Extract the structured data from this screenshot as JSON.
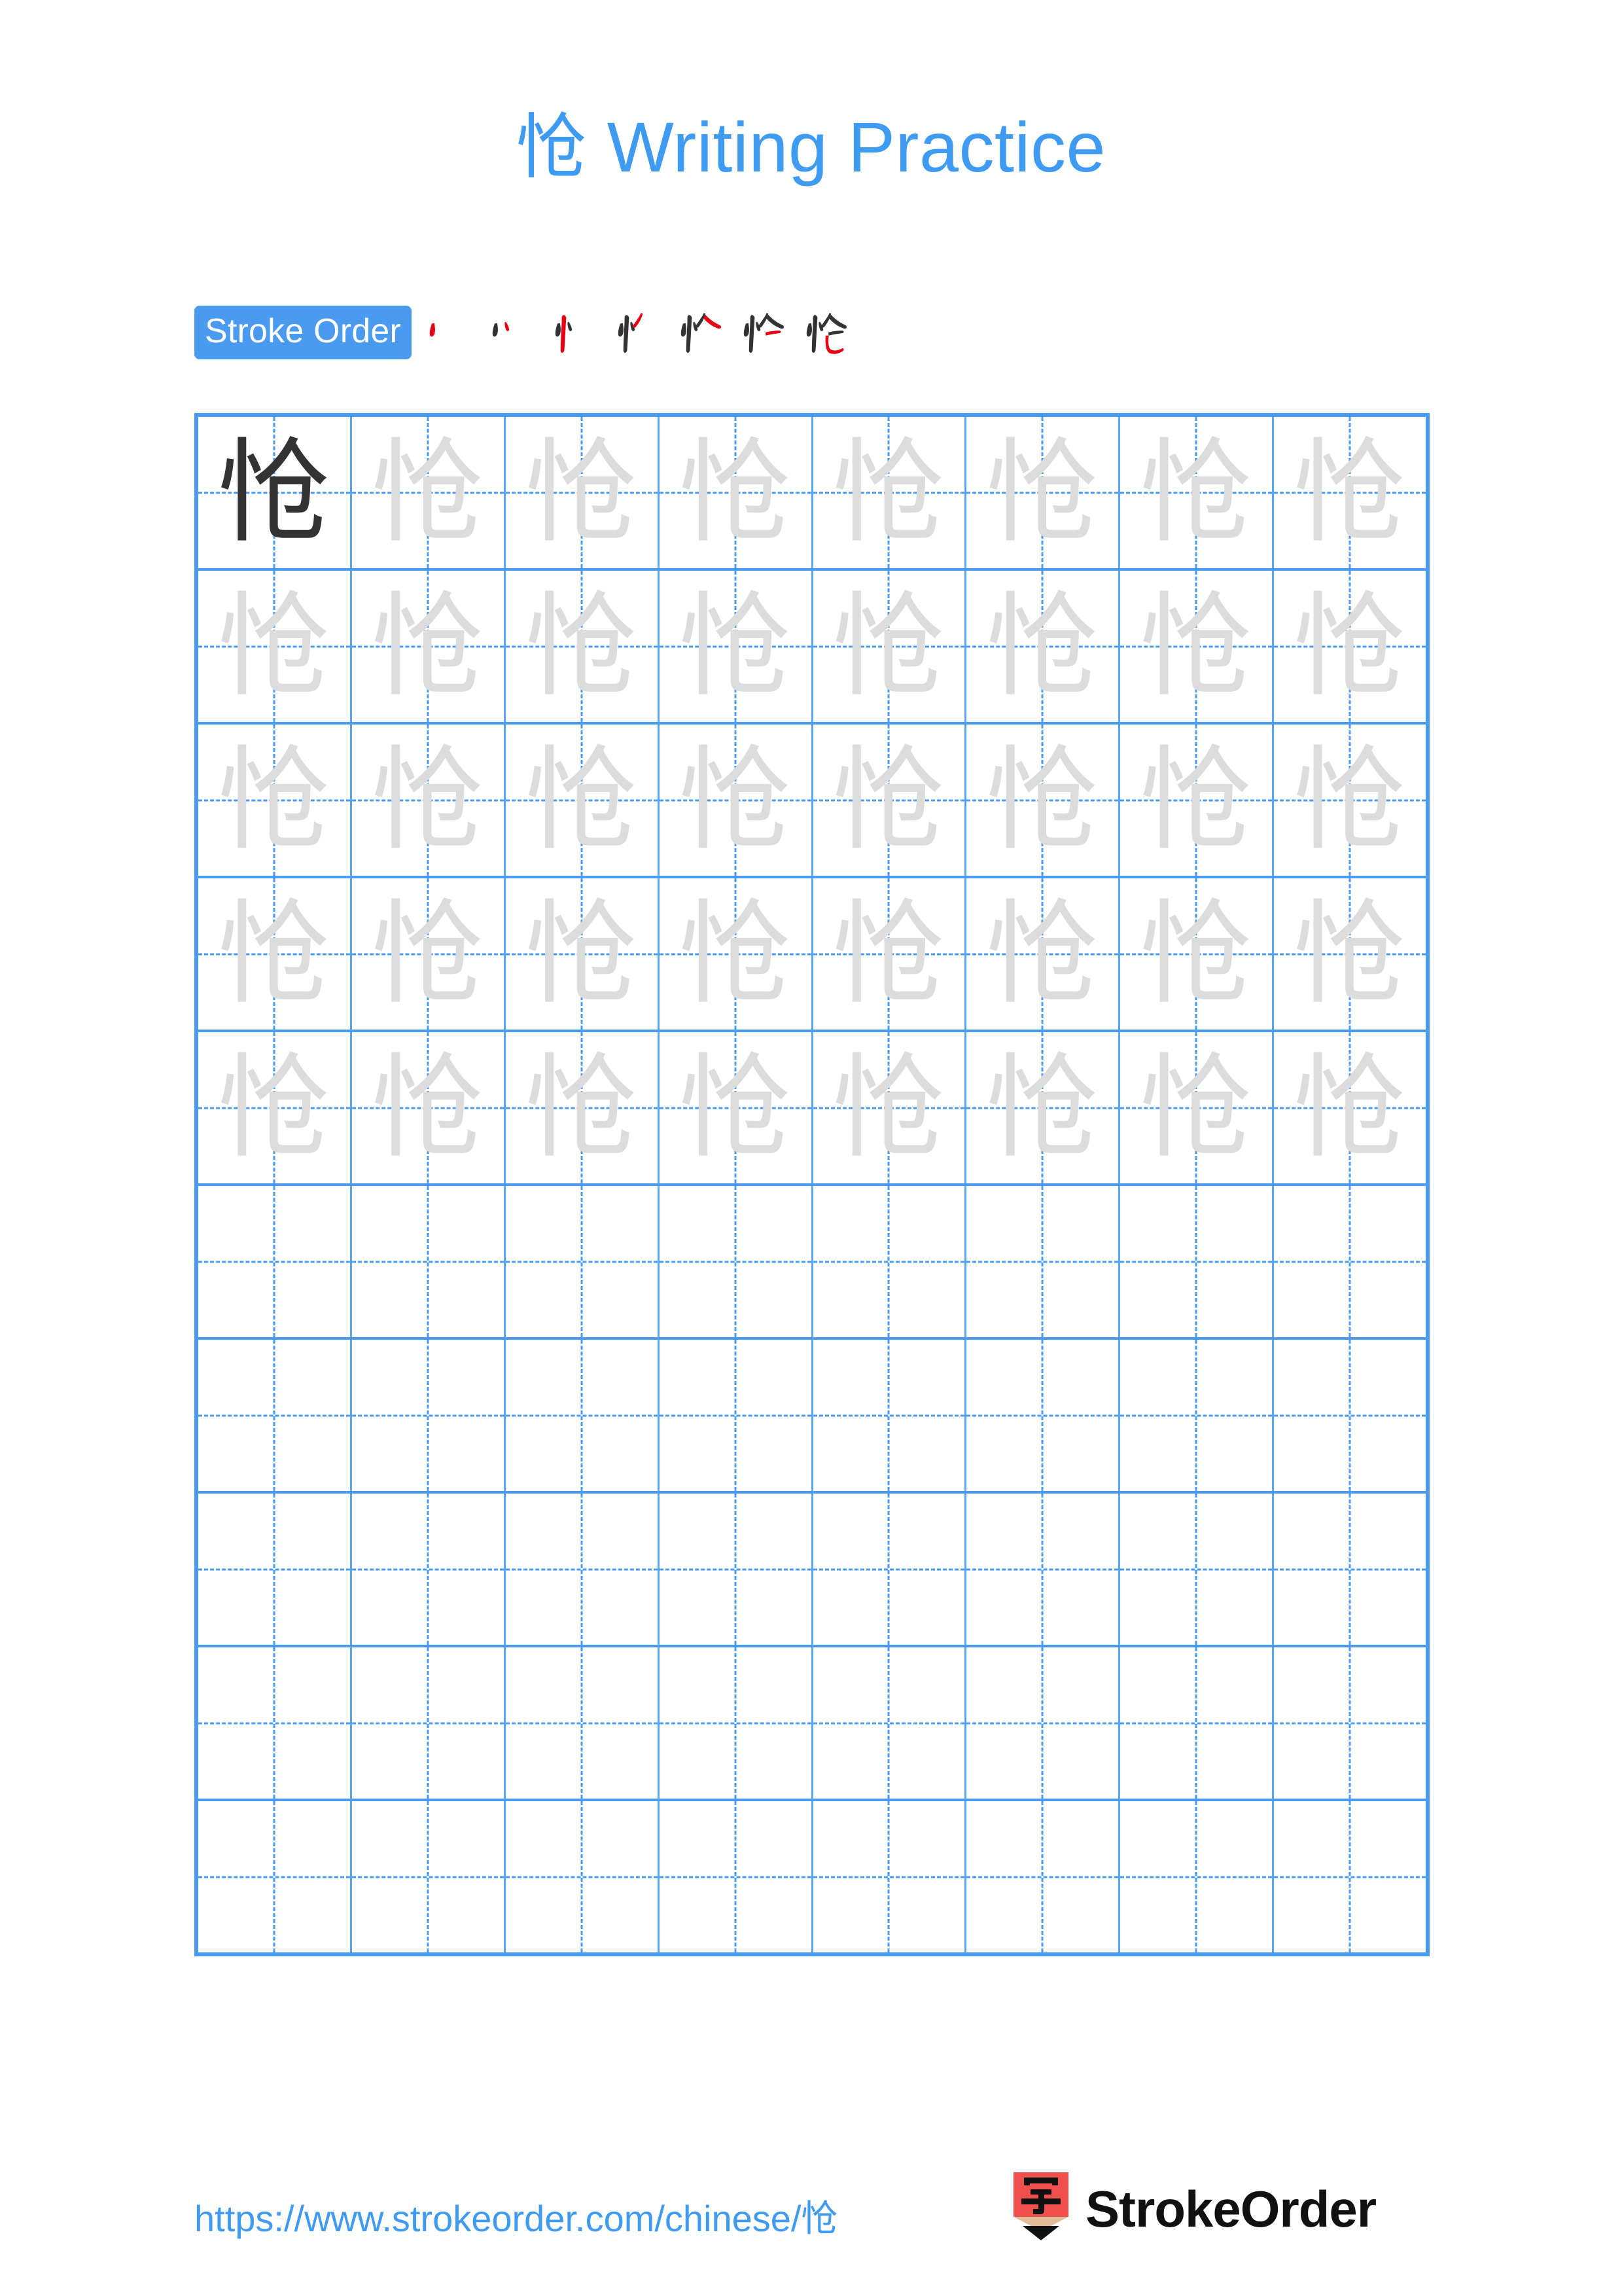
{
  "page": {
    "background_color": "#ffffff",
    "accent_blue": "#3f9bf2",
    "grid_blue": "#4a9bf0",
    "trace_gray": "#dcdcdc",
    "ink_dark": "#333333",
    "stroke_highlight_red": "#e60012"
  },
  "title": {
    "character": "怆",
    "text": " Writing Practice",
    "full": "怆 Writing Practice"
  },
  "stroke_order": {
    "badge_label": "Stroke Order",
    "character": "怆",
    "total_strokes": 7,
    "steps": [
      {
        "index": 1,
        "strokes_shown": 1,
        "new_stroke_color": "#e60012"
      },
      {
        "index": 2,
        "strokes_shown": 2,
        "new_stroke_color": "#e60012"
      },
      {
        "index": 3,
        "strokes_shown": 3,
        "new_stroke_color": "#e60012"
      },
      {
        "index": 4,
        "strokes_shown": 4,
        "new_stroke_color": "#e60012"
      },
      {
        "index": 5,
        "strokes_shown": 5,
        "new_stroke_color": "#e60012"
      },
      {
        "index": 6,
        "strokes_shown": 6,
        "new_stroke_color": "#e60012"
      },
      {
        "index": 7,
        "strokes_shown": 7,
        "new_stroke_color": "#e60012"
      }
    ]
  },
  "grid": {
    "columns": 8,
    "rows": 10,
    "character": "怆",
    "cells": [
      [
        "dark",
        "trace",
        "trace",
        "trace",
        "trace",
        "trace",
        "trace",
        "trace"
      ],
      [
        "trace",
        "trace",
        "trace",
        "trace",
        "trace",
        "trace",
        "trace",
        "trace"
      ],
      [
        "trace",
        "trace",
        "trace",
        "trace",
        "trace",
        "trace",
        "trace",
        "trace"
      ],
      [
        "trace",
        "trace",
        "trace",
        "trace",
        "trace",
        "trace",
        "trace",
        "trace"
      ],
      [
        "trace",
        "trace",
        "trace",
        "trace",
        "trace",
        "trace",
        "trace",
        "trace"
      ],
      [
        "empty",
        "empty",
        "empty",
        "empty",
        "empty",
        "empty",
        "empty",
        "empty"
      ],
      [
        "empty",
        "empty",
        "empty",
        "empty",
        "empty",
        "empty",
        "empty",
        "empty"
      ],
      [
        "empty",
        "empty",
        "empty",
        "empty",
        "empty",
        "empty",
        "empty",
        "empty"
      ],
      [
        "empty",
        "empty",
        "empty",
        "empty",
        "empty",
        "empty",
        "empty",
        "empty"
      ],
      [
        "empty",
        "empty",
        "empty",
        "empty",
        "empty",
        "empty",
        "empty",
        "empty"
      ]
    ]
  },
  "footer": {
    "url": "https://www.strokeorder.com/chinese/怆",
    "brand_name": "StrokeOrder",
    "logo": {
      "icon_name": "pencil-logo-icon",
      "glyph": "字",
      "body_color": "#f0504e",
      "wood_color": "#e3bd9a",
      "tip_color": "#111111"
    }
  }
}
